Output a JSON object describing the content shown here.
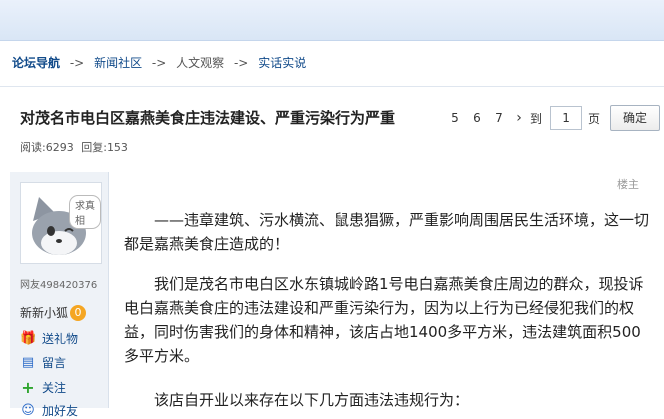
{
  "breadcrumb": {
    "home": "论坛导航",
    "sep": "->",
    "items": [
      "新闻社区",
      "人文观察",
      "实话实说"
    ]
  },
  "thread": {
    "title": "对茂名市电白区嘉燕美食庄违法建设、严重污染行为严重"
  },
  "pager": {
    "pages": [
      "5",
      "6",
      "7"
    ],
    "next": "›",
    "to": "到",
    "current": "1",
    "unit": "页",
    "confirm": "确定"
  },
  "stats": {
    "read_label": "阅读:",
    "read": "6293",
    "reply_label": "回复:",
    "reply": "153"
  },
  "user": {
    "tag": "求真相",
    "name": "网友498420376",
    "level": "新新小狐",
    "level_num": "0",
    "actions": [
      "送礼物",
      "留言",
      "关注",
      "加好友"
    ]
  },
  "post": {
    "floor": "楼主",
    "paragraphs": [
      "——违章建筑、污水横流、鼠患猖獗，严重影响周围居民生活环境，这一切都是嘉燕美食庄造成的！",
      "我们是茂名市电白区水东镇城岭路1号电白嘉燕美食庄周边的群众，现投诉电白嘉燕美食庄的违法建设和严重污染行为，因为以上行为已经侵犯我们的权益，同时伤害我们的身体和精神，该店占地1400多平方米，违法建筑面积500多平方米。",
      "该店自开业以来存在以下几方面违法违规行为："
    ]
  },
  "colors": {
    "link": "#124b8a",
    "topbar": "#dce8f6",
    "panel": "#eef2f7"
  }
}
